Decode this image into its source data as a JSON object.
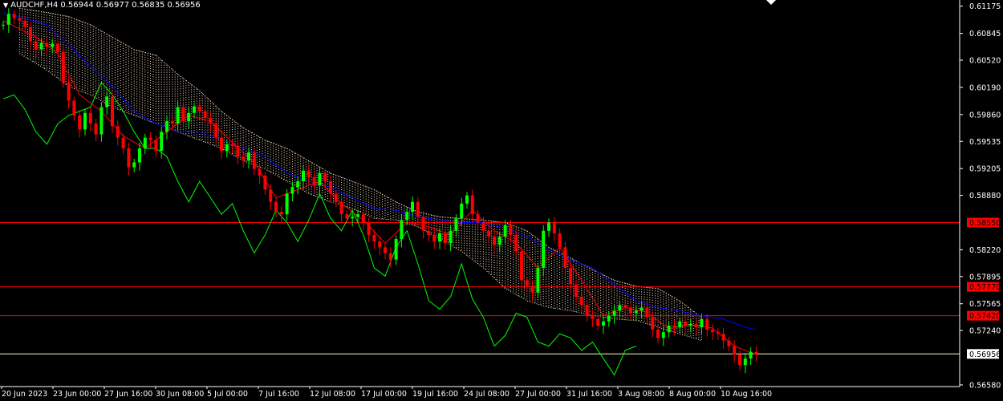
{
  "header": {
    "symbol": "AUDCHF,H4",
    "open": "0.56944",
    "high": "0.56977",
    "low": "0.56835",
    "close": "0.56956"
  },
  "colors": {
    "background": "#000000",
    "axis_text": "#ffffff",
    "bull_candle": "#00ff00",
    "bear_candle": "#ff0000",
    "tenkan_line": "#ff0000",
    "kijun_line": "#0000ff",
    "chikou_line": "#00ff00",
    "kumo_dots": "#ffe4c4",
    "level_line": "#ff0000",
    "price_line": "#ffffc0"
  },
  "chart_data": {
    "type": "candlestick",
    "symbol": "AUDCHF",
    "timeframe": "H4",
    "y_ticks": [
      "0.61175",
      "0.60845",
      "0.60520",
      "0.60190",
      "0.59860",
      "0.59535",
      "0.59205",
      "0.58880",
      "0.58220",
      "0.57895",
      "0.57565",
      "0.57240",
      "0.56580"
    ],
    "ylim": [
      0.5656,
      0.6125
    ],
    "x_ticks": [
      "20 Jun 2023",
      "23 Jun 00:00",
      "27 Jun 16:00",
      "30 Jun 08:00",
      "5 Jul 00:00",
      "7 Jul 16:00",
      "12 Jul 08:00",
      "17 Jul 00:00",
      "19 Jul 16:00",
      "24 Jul 08:00",
      "27 Jul 00:00",
      "31 Jul 16:00",
      "3 Aug 08:00",
      "8 Aug 00:00",
      "10 Aug 16:00"
    ],
    "levels": [
      {
        "label": "0.58550",
        "value": 0.5855
      },
      {
        "label": "0.57770",
        "value": 0.5777
      },
      {
        "label": "0.57420",
        "value": 0.5742
      }
    ],
    "current_price": {
      "label": "0.56956",
      "value": 0.56956
    },
    "close_path": [
      [
        0,
        0.6095
      ],
      [
        1,
        0.6108
      ],
      [
        2,
        0.6103
      ],
      [
        3,
        0.61
      ],
      [
        4,
        0.6092
      ],
      [
        5,
        0.6075
      ],
      [
        6,
        0.6065
      ],
      [
        7,
        0.6073
      ],
      [
        8,
        0.6068
      ],
      [
        9,
        0.6072
      ],
      [
        10,
        0.6062
      ],
      [
        11,
        0.6025
      ],
      [
        12,
        0.6003
      ],
      [
        13,
        0.5985
      ],
      [
        14,
        0.5968
      ],
      [
        15,
        0.5988
      ],
      [
        16,
        0.5975
      ],
      [
        17,
        0.5962
      ],
      [
        18,
        0.5995
      ],
      [
        19,
        0.6008
      ],
      [
        20,
        0.5972
      ],
      [
        21,
        0.5958
      ],
      [
        22,
        0.5945
      ],
      [
        23,
        0.5922
      ],
      [
        24,
        0.5928
      ],
      [
        25,
        0.5945
      ],
      [
        26,
        0.5958
      ],
      [
        27,
        0.5955
      ],
      [
        28,
        0.5942
      ],
      [
        29,
        0.5965
      ],
      [
        30,
        0.5978
      ],
      [
        31,
        0.5975
      ],
      [
        32,
        0.5995
      ],
      [
        33,
        0.5978
      ],
      [
        34,
        0.5988
      ],
      [
        35,
        0.5996
      ],
      [
        36,
        0.599
      ],
      [
        37,
        0.5982
      ],
      [
        38,
        0.5975
      ],
      [
        39,
        0.5958
      ],
      [
        40,
        0.5942
      ],
      [
        41,
        0.595
      ],
      [
        42,
        0.5948
      ],
      [
        43,
        0.5935
      ],
      [
        44,
        0.593
      ],
      [
        45,
        0.594
      ],
      [
        46,
        0.592
      ],
      [
        47,
        0.5912
      ],
      [
        48,
        0.5895
      ],
      [
        49,
        0.588
      ],
      [
        50,
        0.5868
      ],
      [
        51,
        0.5865
      ],
      [
        52,
        0.589
      ],
      [
        53,
        0.5898
      ],
      [
        54,
        0.5905
      ],
      [
        55,
        0.5918
      ],
      [
        56,
        0.591
      ],
      [
        57,
        0.59
      ],
      [
        58,
        0.5915
      ],
      [
        59,
        0.5905
      ],
      [
        60,
        0.589
      ],
      [
        61,
        0.588
      ],
      [
        62,
        0.5865
      ],
      [
        63,
        0.586
      ],
      [
        64,
        0.5862
      ],
      [
        65,
        0.5865
      ],
      [
        66,
        0.5855
      ],
      [
        67,
        0.584
      ],
      [
        68,
        0.5832
      ],
      [
        69,
        0.5825
      ],
      [
        70,
        0.5818
      ],
      [
        71,
        0.581
      ],
      [
        72,
        0.5835
      ],
      [
        73,
        0.5858
      ],
      [
        74,
        0.5868
      ],
      [
        75,
        0.588
      ],
      [
        76,
        0.5862
      ],
      [
        77,
        0.5845
      ],
      [
        78,
        0.584
      ],
      [
        79,
        0.5832
      ],
      [
        80,
        0.5842
      ],
      [
        81,
        0.583
      ],
      [
        82,
        0.5845
      ],
      [
        83,
        0.586
      ],
      [
        84,
        0.5878
      ],
      [
        85,
        0.5888
      ],
      [
        86,
        0.5865
      ],
      [
        87,
        0.5855
      ],
      [
        88,
        0.5845
      ],
      [
        89,
        0.5838
      ],
      [
        90,
        0.5828
      ],
      [
        91,
        0.5838
      ],
      [
        92,
        0.5852
      ],
      [
        93,
        0.584
      ],
      [
        94,
        0.582
      ],
      [
        95,
        0.5785
      ],
      [
        96,
        0.5778
      ],
      [
        97,
        0.577
      ],
      [
        98,
        0.58
      ],
      [
        99,
        0.5845
      ],
      [
        100,
        0.5855
      ],
      [
        101,
        0.5842
      ],
      [
        102,
        0.5825
      ],
      [
        103,
        0.58
      ],
      [
        104,
        0.578
      ],
      [
        105,
        0.5765
      ],
      [
        106,
        0.5755
      ],
      [
        107,
        0.5742
      ],
      [
        108,
        0.5738
      ],
      [
        109,
        0.573
      ],
      [
        110,
        0.5735
      ],
      [
        111,
        0.5742
      ],
      [
        112,
        0.5748
      ],
      [
        113,
        0.5755
      ],
      [
        114,
        0.5752
      ],
      [
        115,
        0.5745
      ],
      [
        116,
        0.5748
      ],
      [
        117,
        0.5752
      ],
      [
        118,
        0.574
      ],
      [
        119,
        0.5725
      ],
      [
        120,
        0.5715
      ],
      [
        121,
        0.5722
      ],
      [
        122,
        0.573
      ],
      [
        123,
        0.5728
      ],
      [
        124,
        0.5735
      ],
      [
        125,
        0.573
      ],
      [
        126,
        0.5732
      ],
      [
        127,
        0.5728
      ],
      [
        128,
        0.5738
      ],
      [
        129,
        0.5725
      ],
      [
        130,
        0.5722
      ],
      [
        131,
        0.572
      ],
      [
        132,
        0.5712
      ],
      [
        133,
        0.5705
      ],
      [
        134,
        0.5695
      ],
      [
        135,
        0.5682
      ],
      [
        136,
        0.569
      ],
      [
        137,
        0.5698
      ],
      [
        138,
        0.5696
      ]
    ],
    "tenkan_path": [
      [
        0,
        0.61
      ],
      [
        6,
        0.608
      ],
      [
        10,
        0.606
      ],
      [
        14,
        0.601
      ],
      [
        18,
        0.599
      ],
      [
        22,
        0.596
      ],
      [
        26,
        0.5945
      ],
      [
        30,
        0.5965
      ],
      [
        34,
        0.5985
      ],
      [
        38,
        0.5978
      ],
      [
        42,
        0.5952
      ],
      [
        46,
        0.5928
      ],
      [
        50,
        0.5885
      ],
      [
        54,
        0.5895
      ],
      [
        58,
        0.5905
      ],
      [
        62,
        0.5878
      ],
      [
        66,
        0.5858
      ],
      [
        70,
        0.583
      ],
      [
        74,
        0.5855
      ],
      [
        78,
        0.585
      ],
      [
        82,
        0.584
      ],
      [
        86,
        0.587
      ],
      [
        90,
        0.5845
      ],
      [
        94,
        0.583
      ],
      [
        98,
        0.58
      ],
      [
        102,
        0.5825
      ],
      [
        106,
        0.5785
      ],
      [
        110,
        0.5742
      ],
      [
        114,
        0.5752
      ],
      [
        118,
        0.5746
      ],
      [
        122,
        0.5726
      ],
      [
        126,
        0.5731
      ],
      [
        130,
        0.5727
      ],
      [
        134,
        0.5705
      ],
      [
        138,
        0.5695
      ]
    ],
    "kijun_path": [
      [
        0,
        0.611
      ],
      [
        8,
        0.6095
      ],
      [
        12,
        0.607
      ],
      [
        16,
        0.6045
      ],
      [
        20,
        0.602
      ],
      [
        24,
        0.599
      ],
      [
        28,
        0.5975
      ],
      [
        32,
        0.5965
      ],
      [
        36,
        0.5965
      ],
      [
        40,
        0.5955
      ],
      [
        44,
        0.5945
      ],
      [
        48,
        0.5935
      ],
      [
        52,
        0.5915
      ],
      [
        56,
        0.5905
      ],
      [
        60,
        0.5898
      ],
      [
        64,
        0.5885
      ],
      [
        68,
        0.5872
      ],
      [
        72,
        0.587
      ],
      [
        76,
        0.5862
      ],
      [
        80,
        0.5858
      ],
      [
        84,
        0.5855
      ],
      [
        88,
        0.5855
      ],
      [
        92,
        0.5848
      ],
      [
        96,
        0.5838
      ],
      [
        100,
        0.5822
      ],
      [
        104,
        0.581
      ],
      [
        108,
        0.58
      ],
      [
        112,
        0.578
      ],
      [
        116,
        0.576
      ],
      [
        120,
        0.5752
      ],
      [
        124,
        0.5748
      ],
      [
        128,
        0.5742
      ],
      [
        132,
        0.5738
      ],
      [
        136,
        0.5728
      ],
      [
        138,
        0.5725
      ]
    ],
    "chikou_path": [
      [
        0,
        0.6005
      ],
      [
        2,
        0.601
      ],
      [
        4,
        0.5992
      ],
      [
        6,
        0.5965
      ],
      [
        8,
        0.595
      ],
      [
        10,
        0.5975
      ],
      [
        12,
        0.5985
      ],
      [
        14,
        0.599
      ],
      [
        16,
        0.5995
      ],
      [
        18,
        0.6025
      ],
      [
        20,
        0.601
      ],
      [
        22,
        0.599
      ],
      [
        24,
        0.5965
      ],
      [
        26,
        0.5945
      ],
      [
        28,
        0.5945
      ],
      [
        30,
        0.5935
      ],
      [
        32,
        0.5905
      ],
      [
        34,
        0.588
      ],
      [
        36,
        0.5905
      ],
      [
        38,
        0.5885
      ],
      [
        40,
        0.5865
      ],
      [
        42,
        0.5878
      ],
      [
        44,
        0.5845
      ],
      [
        46,
        0.5818
      ],
      [
        48,
        0.584
      ],
      [
        50,
        0.587
      ],
      [
        52,
        0.5855
      ],
      [
        54,
        0.5832
      ],
      [
        56,
        0.5858
      ],
      [
        58,
        0.589
      ],
      [
        60,
        0.586
      ],
      [
        62,
        0.5845
      ],
      [
        64,
        0.587
      ],
      [
        66,
        0.584
      ],
      [
        68,
        0.58
      ],
      [
        70,
        0.579
      ],
      [
        72,
        0.5825
      ],
      [
        74,
        0.5845
      ],
      [
        76,
        0.5805
      ],
      [
        78,
        0.576
      ],
      [
        80,
        0.575
      ],
      [
        82,
        0.5765
      ],
      [
        84,
        0.5805
      ],
      [
        86,
        0.5762
      ],
      [
        88,
        0.574
      ],
      [
        90,
        0.5705
      ],
      [
        92,
        0.5718
      ],
      [
        94,
        0.5745
      ],
      [
        96,
        0.574
      ],
      [
        98,
        0.571
      ],
      [
        100,
        0.5705
      ],
      [
        102,
        0.572
      ],
      [
        104,
        0.5715
      ],
      [
        106,
        0.57
      ],
      [
        108,
        0.571
      ],
      [
        110,
        0.569
      ],
      [
        112,
        0.567
      ],
      [
        114,
        0.57
      ],
      [
        116,
        0.5705
      ]
    ],
    "kumo_upper": [
      [
        3,
        0.6115
      ],
      [
        8,
        0.611
      ],
      [
        12,
        0.6105
      ],
      [
        16,
        0.6095
      ],
      [
        20,
        0.608
      ],
      [
        24,
        0.6065
      ],
      [
        28,
        0.6058
      ],
      [
        32,
        0.6035
      ],
      [
        36,
        0.6015
      ],
      [
        40,
        0.599
      ],
      [
        44,
        0.597
      ],
      [
        48,
        0.5955
      ],
      [
        52,
        0.5945
      ],
      [
        56,
        0.593
      ],
      [
        60,
        0.5915
      ],
      [
        64,
        0.5905
      ],
      [
        68,
        0.5895
      ],
      [
        72,
        0.588
      ],
      [
        76,
        0.5868
      ],
      [
        80,
        0.5862
      ],
      [
        84,
        0.586
      ],
      [
        88,
        0.5858
      ],
      [
        92,
        0.5855
      ],
      [
        96,
        0.5845
      ],
      [
        100,
        0.5825
      ],
      [
        104,
        0.5812
      ],
      [
        108,
        0.5798
      ],
      [
        112,
        0.5785
      ],
      [
        116,
        0.5778
      ],
      [
        120,
        0.5775
      ],
      [
        124,
        0.576
      ],
      [
        128,
        0.574
      ]
    ],
    "kumo_lower": [
      [
        3,
        0.606
      ],
      [
        8,
        0.604
      ],
      [
        12,
        0.602
      ],
      [
        16,
        0.601
      ],
      [
        20,
        0.5995
      ],
      [
        24,
        0.5985
      ],
      [
        28,
        0.5975
      ],
      [
        32,
        0.5965
      ],
      [
        36,
        0.5955
      ],
      [
        40,
        0.5945
      ],
      [
        44,
        0.593
      ],
      [
        48,
        0.592
      ],
      [
        52,
        0.5905
      ],
      [
        56,
        0.589
      ],
      [
        60,
        0.588
      ],
      [
        64,
        0.5872
      ],
      [
        68,
        0.586
      ],
      [
        72,
        0.5858
      ],
      [
        76,
        0.585
      ],
      [
        80,
        0.5835
      ],
      [
        84,
        0.582
      ],
      [
        88,
        0.58
      ],
      [
        92,
        0.5775
      ],
      [
        96,
        0.576
      ],
      [
        100,
        0.5752
      ],
      [
        104,
        0.5748
      ],
      [
        108,
        0.5742
      ],
      [
        112,
        0.5738
      ],
      [
        116,
        0.5736
      ],
      [
        120,
        0.5728
      ],
      [
        124,
        0.572
      ],
      [
        128,
        0.5712
      ]
    ]
  }
}
